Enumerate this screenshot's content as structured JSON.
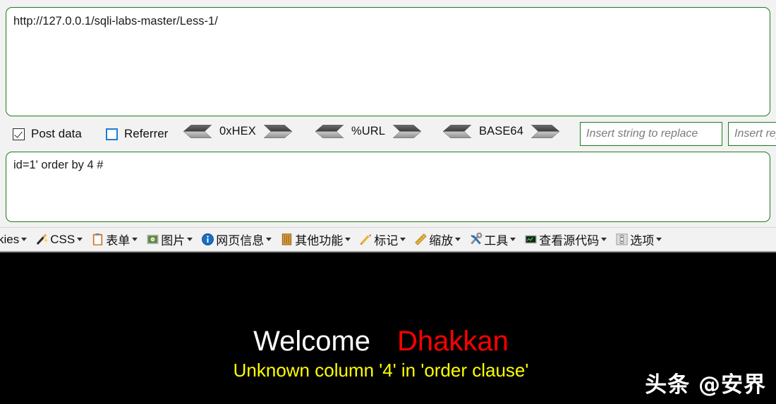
{
  "hackbar": {
    "url_value": "http://127.0.0.1/sqli-labs-master/Less-1/",
    "payload_value": "id=1' order by 4 #",
    "checkboxes": [
      {
        "label": "Post data",
        "checked": true
      },
      {
        "label": "Referrer",
        "checked": false
      }
    ],
    "encodings": [
      {
        "label": "0xHEX"
      },
      {
        "label": "%URL"
      },
      {
        "label": "BASE64"
      }
    ],
    "replace_inputs": [
      {
        "placeholder": "Insert string to replace"
      },
      {
        "placeholder": "Insert replacement"
      }
    ],
    "accent_border": "#1f7a1f",
    "panel_bg": "#f2f2f2"
  },
  "devbar": {
    "items": [
      {
        "label": "kies",
        "icon": "cookie-icon"
      },
      {
        "label": "CSS",
        "icon": "wand-icon"
      },
      {
        "label": "表单",
        "icon": "clipboard-icon"
      },
      {
        "label": "图片",
        "icon": "image-icon"
      },
      {
        "label": "网页信息",
        "icon": "info-icon"
      },
      {
        "label": "其他功能",
        "icon": "book-icon"
      },
      {
        "label": "标记",
        "icon": "pencil-icon"
      },
      {
        "label": "缩放",
        "icon": "ruler-icon"
      },
      {
        "label": "工具",
        "icon": "wrench-icon"
      },
      {
        "label": "查看源代码",
        "icon": "monitor-icon"
      },
      {
        "label": "选项",
        "icon": "options-icon"
      }
    ]
  },
  "page": {
    "welcome": "Welcome",
    "brand": "Dhakkan",
    "error": "Unknown column '4' in 'order clause'",
    "watermark": "头条 @安界",
    "bg": "#000000",
    "welcome_color": "#ffffff",
    "brand_color": "#ff0000",
    "error_color": "#ffff00"
  }
}
